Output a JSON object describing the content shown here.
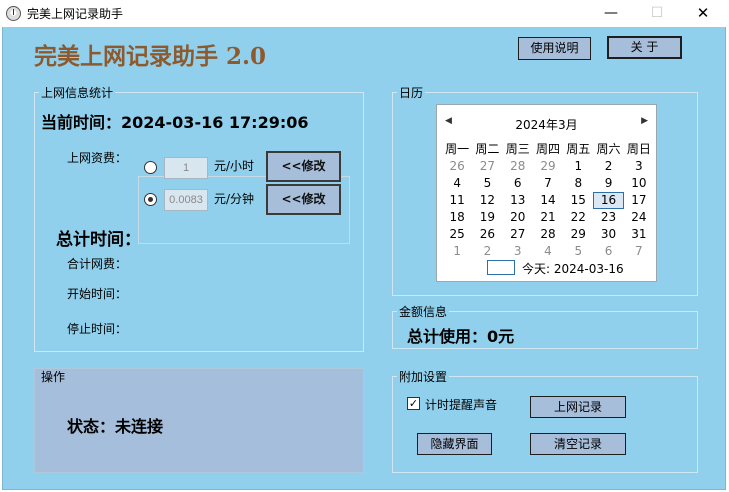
{
  "window": {
    "title": "完美上网记录助手",
    "min_glyph": "—",
    "max_glyph": "☐",
    "close_glyph": "✕"
  },
  "header": {
    "app_title": "完美上网记录助手 2.0",
    "help_label": "使用说明",
    "about_label": "关 于"
  },
  "stats": {
    "legend": "上网信息统计",
    "current_time": "当前时间：2024-03-16 17:29:06",
    "rate_label": "上网资费：",
    "rates": [
      {
        "value": "1",
        "unit": "元/小时",
        "selected": false,
        "modify_label": "<<修改"
      },
      {
        "value": "0.0083",
        "unit": "元/分钟",
        "selected": true,
        "modify_label": "<<修改"
      }
    ],
    "total_title": "总计时间：",
    "total_fee_label": "合计网费：",
    "start_time_label": "开始时间：",
    "stop_time_label": "停止时间："
  },
  "operation": {
    "legend": "操作",
    "status": "状态：未连接"
  },
  "calendar": {
    "legend": "日历",
    "month_label": "2024年3月",
    "prev_glyph": "◀",
    "next_glyph": "▶",
    "weekdays": [
      "周一",
      "周二",
      "周三",
      "周四",
      "周五",
      "周六",
      "周日"
    ],
    "rows": [
      [
        "26",
        "27",
        "28",
        "29",
        "1",
        "2",
        "3"
      ],
      [
        "4",
        "5",
        "6",
        "7",
        "8",
        "9",
        "10"
      ],
      [
        "11",
        "12",
        "13",
        "14",
        "15",
        "16",
        "17"
      ],
      [
        "18",
        "19",
        "20",
        "21",
        "22",
        "23",
        "24"
      ],
      [
        "25",
        "26",
        "27",
        "28",
        "29",
        "30",
        "31"
      ],
      [
        "1",
        "2",
        "3",
        "4",
        "5",
        "6",
        "7"
      ]
    ],
    "today_text": "今天: 2024-03-16"
  },
  "amount": {
    "legend": "金额信息",
    "total_used": "总计使用：0元"
  },
  "extra": {
    "legend": "附加设置",
    "reminder_label": "计时提醒声音",
    "reminder_checked": true,
    "records_label": "上网记录",
    "hide_label": "隐藏界面",
    "clear_label": "清空记录"
  }
}
